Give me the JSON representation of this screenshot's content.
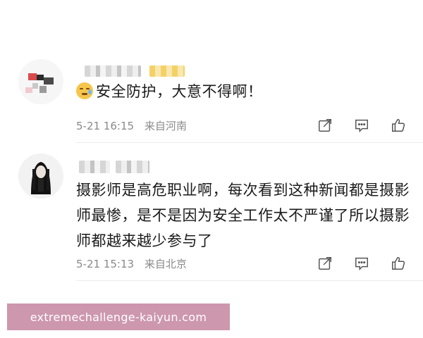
{
  "comments": [
    {
      "text": "安全防护，大意不得啊！",
      "date": "5-21 16:15",
      "location": "来自河南",
      "emoji": "sweat-emoji"
    },
    {
      "text": "摄影师是高危职业啊，每次看到这种新闻都是摄影师最惨，是不是因为安全工作太不严谨了所以摄影师都越来越少参与了",
      "date": "5-21 15:13",
      "location": "来自北京"
    }
  ],
  "icons": {
    "share": "share-icon",
    "comment": "comment-icon",
    "like": "thumbs-up-icon"
  },
  "watermark": "extremechallenge-kaiyun.com",
  "colors": {
    "meta_text": "#8a8a8a",
    "watermark_bg": "#c98fa8"
  }
}
